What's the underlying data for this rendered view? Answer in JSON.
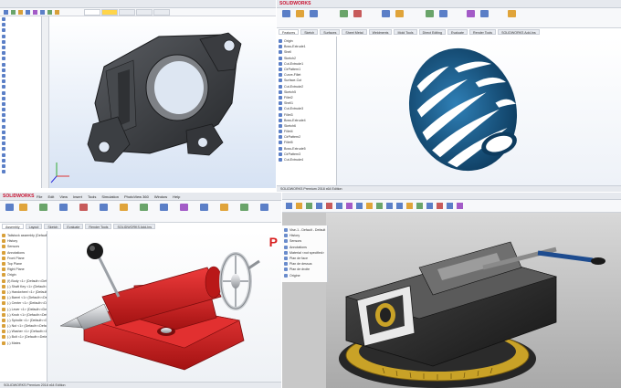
{
  "top_left": {
    "tree_items": [
      "",
      "",
      "",
      "",
      "",
      "",
      "",
      "",
      "",
      "",
      "",
      "",
      "",
      "",
      "",
      "",
      "",
      "",
      "",
      "",
      "",
      "",
      "",
      "",
      "",
      "",
      "",
      ""
    ],
    "colors": {
      "viewport": "#dbe6f5",
      "part": "#3c3e42",
      "tree_icon": "#5b7fc7"
    }
  },
  "top_right": {
    "logo": "SOLIDWORKS",
    "tabs": [
      "Features",
      "Sketch",
      "Surfaces",
      "Sheet Metal",
      "Weldments",
      "Mold Tools",
      "Direct Editing",
      "Evaluate",
      "Render Tools",
      "SOLIDWORKS Add-Ins"
    ],
    "tree_items": [
      "Origin",
      "Boss-Extrude1",
      "Shell",
      "Sketch2",
      "Cut-Extrude1",
      "CirPattern1",
      "Curve-Fillet",
      "Surface-Cut",
      "Cut-Extrude2",
      "Sketch5",
      "Fillet2",
      "Shell1",
      "Cut-Extrude3",
      "Fillet3",
      "Boss-Extrude4",
      "Sketch6",
      "Fillet4",
      "CirPattern2",
      "Fillet5",
      "Boss-Extrude5",
      "CirPattern3",
      "Cut-Extrude4"
    ],
    "bottom_tabs": [
      "Model",
      "3D Views",
      "Motion Study 1"
    ],
    "status": "SOLIDWORKS Premium 2018 x64 Edition",
    "colors": {
      "part": "#1d5f8c",
      "part_dark": "#0f3f63"
    }
  },
  "bottom_left": {
    "logo": "SOLIDWORKS",
    "menus": [
      "File",
      "Edit",
      "View",
      "Insert",
      "Tools",
      "Simulation",
      "PhotoView 360",
      "Window",
      "Help"
    ],
    "tabs": [
      "Assembly",
      "Layout",
      "Sketch",
      "Evaluate",
      "Render Tools",
      "SOLIDWORKS Add-Ins"
    ],
    "tree_items": [
      "Tailstock assembly (Default<Display State-1>)",
      "History",
      "Sensors",
      "Annotations",
      "Front Plane",
      "Top Plane",
      "Right Plane",
      "Origin",
      "(f) Body <1> (Default<<Default>",
      "(-) Shaft Key <1> (Default<<Def",
      "(-) Handwheel <1> (Default<<De",
      "(-) Barrel <1> (Default<<Default",
      "(-) Center <1> (Default<<Defa",
      "(-) Lever <1> (Default<<Defau",
      "(-) Knob <1> (Default<<Default",
      "(-) Spindle <1> (Default<<Defa",
      "(-) Nut <1> (Default<<Default",
      "(-) Washer <1> (Default<<Defau",
      "(-) Bolt <1> (Default<<Default",
      "(-) Mates"
    ],
    "badge": "P",
    "status": "SOLIDWORKS Premium 2018 x64 Edition",
    "colors": {
      "body": "#d91e1e",
      "body_dark": "#9e1010",
      "metal": "#c9ccd0",
      "knob": "#1a1a1a"
    }
  },
  "bottom_right": {
    "tree_items": [
      "Vise-1 - Default - Default",
      "History",
      "Sensors",
      "Annotations",
      "Material <not specified>",
      "Plan de face",
      "Plan de dessus",
      "Plan de droite",
      "Origine"
    ],
    "colors": {
      "background": "#c8c8c8",
      "body": "#2b2b2b",
      "accent": "#c9a227",
      "handle": "#1e4c8f"
    }
  }
}
